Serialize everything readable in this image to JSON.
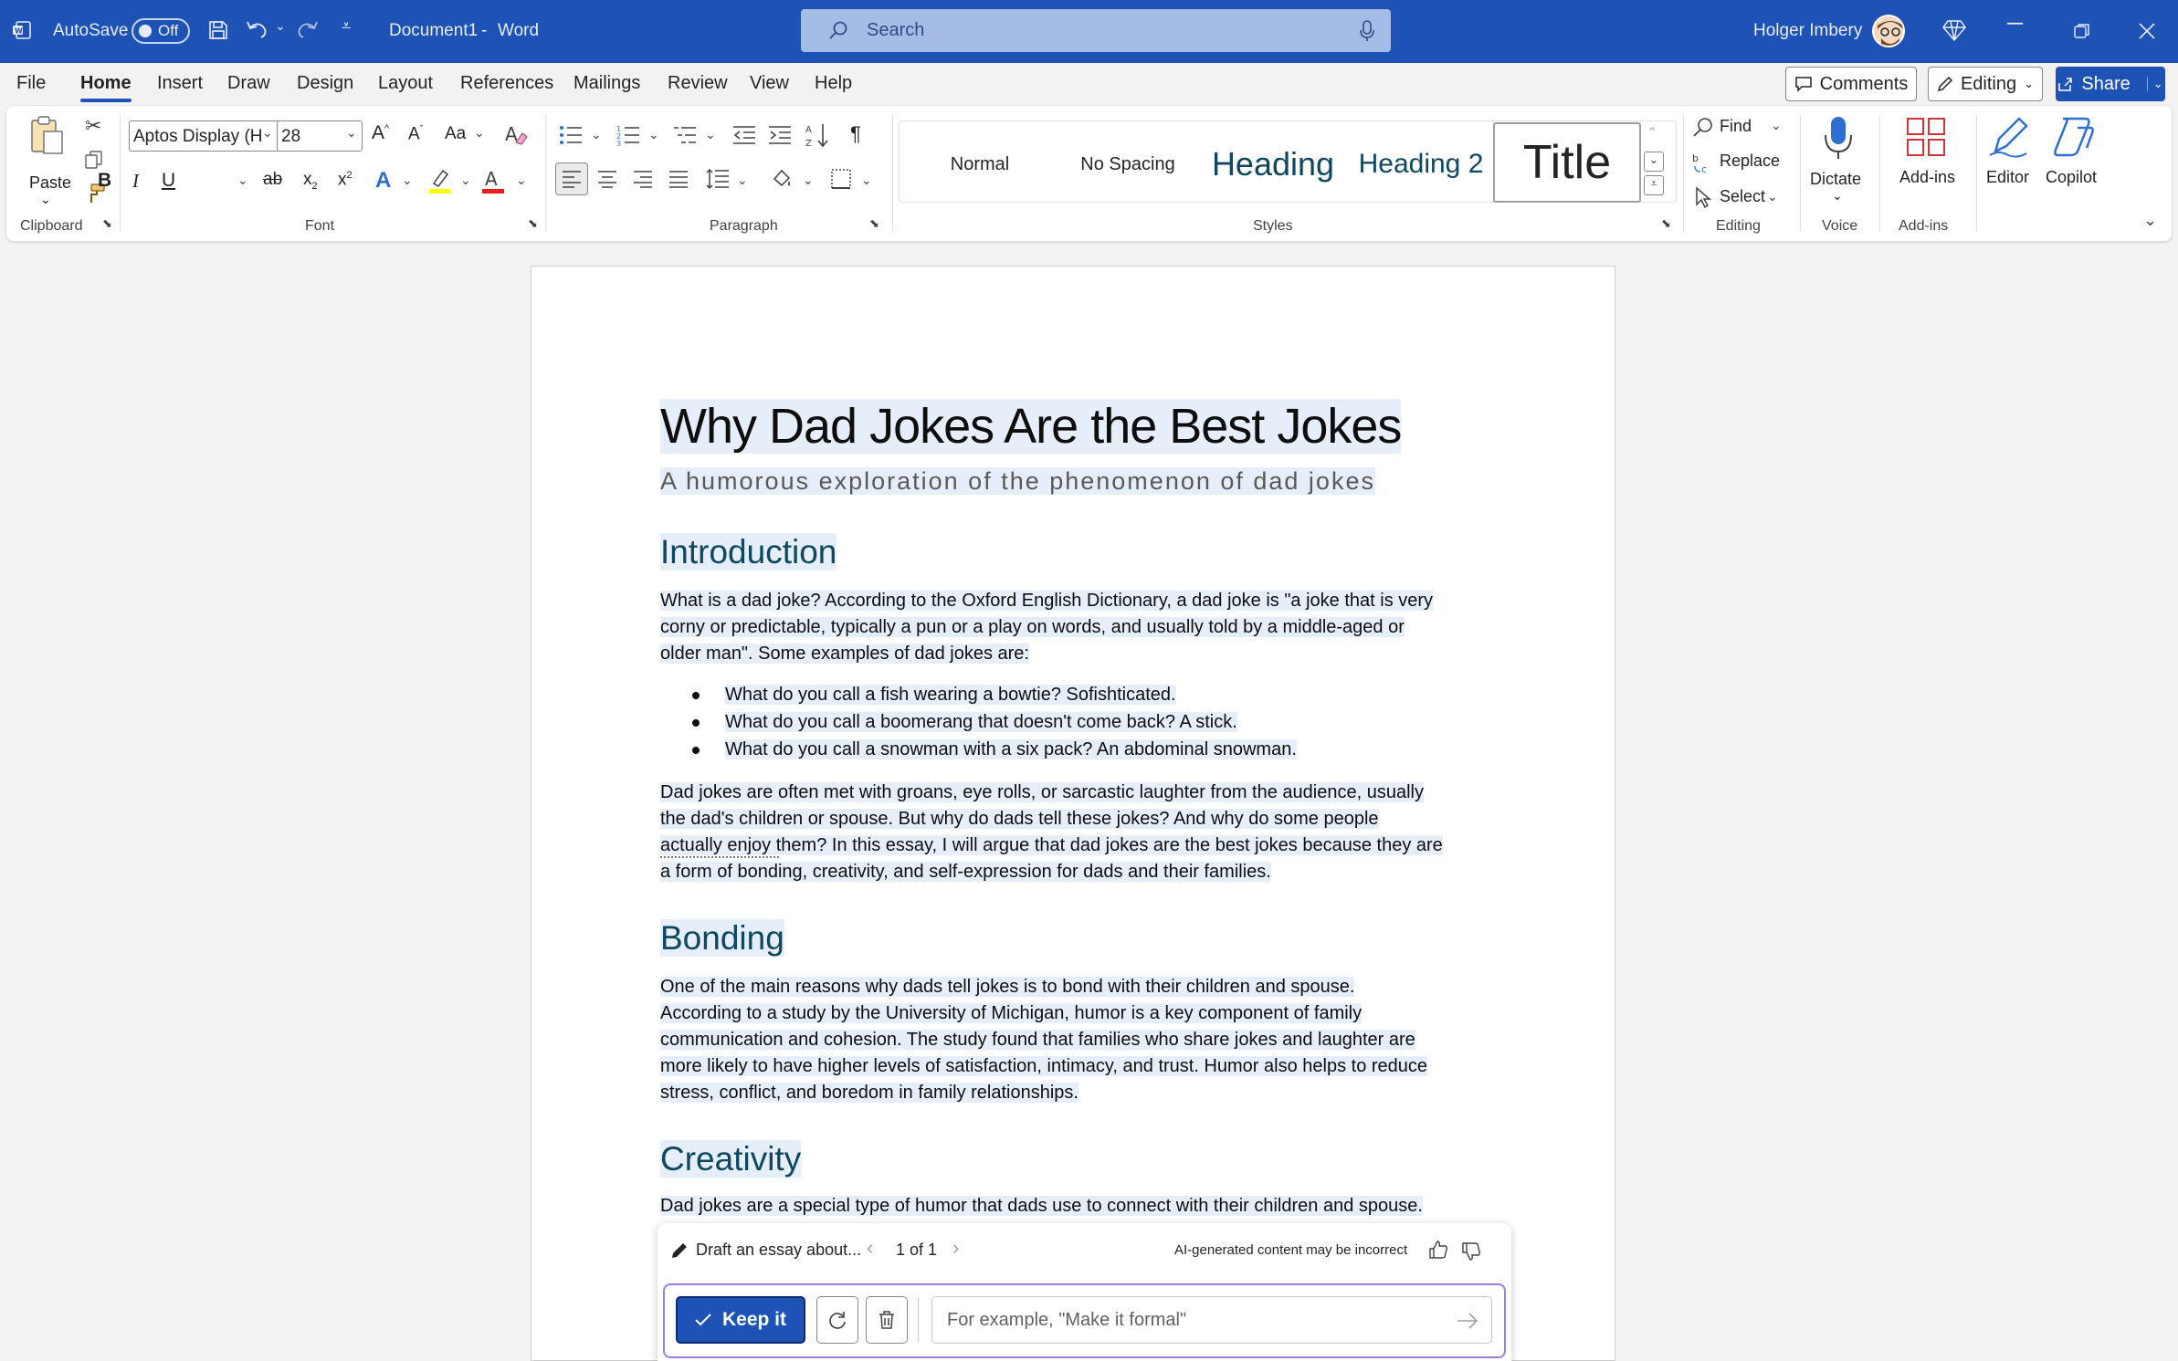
{
  "titlebar": {
    "autosave_label": "AutoSave",
    "autosave_state": "Off",
    "document_name": "Document1",
    "app_separator": "-",
    "app_name": "Word",
    "search_placeholder": "Search",
    "user_name": "Holger Imbery"
  },
  "menu": {
    "tabs": [
      "File",
      "Home",
      "Insert",
      "Draw",
      "Design",
      "Layout",
      "References",
      "Mailings",
      "Review",
      "View",
      "Help"
    ],
    "active_tab": "Home",
    "comments_label": "Comments",
    "editing_label": "Editing",
    "share_label": "Share"
  },
  "ribbon": {
    "clipboard": {
      "paste_label": "Paste",
      "group_label": "Clipboard"
    },
    "font": {
      "font_name": "Aptos Display (H",
      "font_size": "28",
      "group_label": "Font",
      "case_label": "Aa"
    },
    "paragraph": {
      "group_label": "Paragraph"
    },
    "styles": {
      "items": [
        "Normal",
        "No Spacing",
        "Heading",
        "Heading 2",
        "Title"
      ],
      "group_label": "Styles"
    },
    "editing": {
      "find_label": "Find",
      "replace_label": "Replace",
      "select_label": "Select",
      "group_label": "Editing"
    },
    "voice": {
      "dictate_label": "Dictate",
      "group_label": "Voice"
    },
    "addins": {
      "addins_label": "Add-ins",
      "group_label": "Add-ins"
    },
    "editor_label": "Editor",
    "copilot_label": "Copilot"
  },
  "document": {
    "title": "Why Dad Jokes Are the Best Jokes",
    "subtitle": "A humorous exploration of the phenomenon of dad jokes",
    "sections": {
      "intro_heading": "Introduction",
      "intro_lines": [
        "What is a dad joke? According to the Oxford English Dictionary, a dad joke is \"a joke that is very",
        "corny or predictable, typically a pun or a play on words, and usually told by a middle-aged or",
        "older man\". Some examples of dad jokes are:"
      ],
      "bullets": [
        "What do you call a fish wearing a bowtie? Sofishticated.",
        "What do you call a boomerang that doesn't come back? A stick.",
        "What do you call a snowman with a six pack? An abdominal snowman."
      ],
      "intro2_lines": [
        "Dad jokes are often met with groans, eye rolls, or sarcastic laughter from the audience, usually",
        "the dad's children or spouse. But why do dads tell these jokes? And why do some people",
        "actually enjoy them? In this essay, I will argue that dad jokes are the best jokes because they are",
        "a form of bonding, creativity, and self-expression for dads and their families."
      ],
      "bonding_heading": "Bonding",
      "bonding_lines": [
        "One of the main reasons why dads tell jokes is to bond with their children and spouse.",
        "According to a study by the University of Michigan, humor is a key component of family",
        "communication and cohesion. The study found that families who share jokes and laughter are",
        "more likely to have higher levels of satisfaction, intimacy, and trust. Humor also helps to reduce",
        "stress, conflict, and boredom in family relationships."
      ],
      "creativity_heading": "Creativity",
      "creativity_lines": [
        "Dad jokes are a special type of humor that dads use to connect with their children and spouse."
      ]
    }
  },
  "copilot": {
    "prompt_label": "Draft an essay about...",
    "pager": "1 of 1",
    "disclaimer": "AI-generated content may be incorrect",
    "keep_label": "Keep it",
    "input_placeholder": "For example, \"Make it formal\""
  },
  "colors": {
    "titlebar": "#1e52b4",
    "accent": "#1e52b4",
    "heading": "#0f4761"
  }
}
